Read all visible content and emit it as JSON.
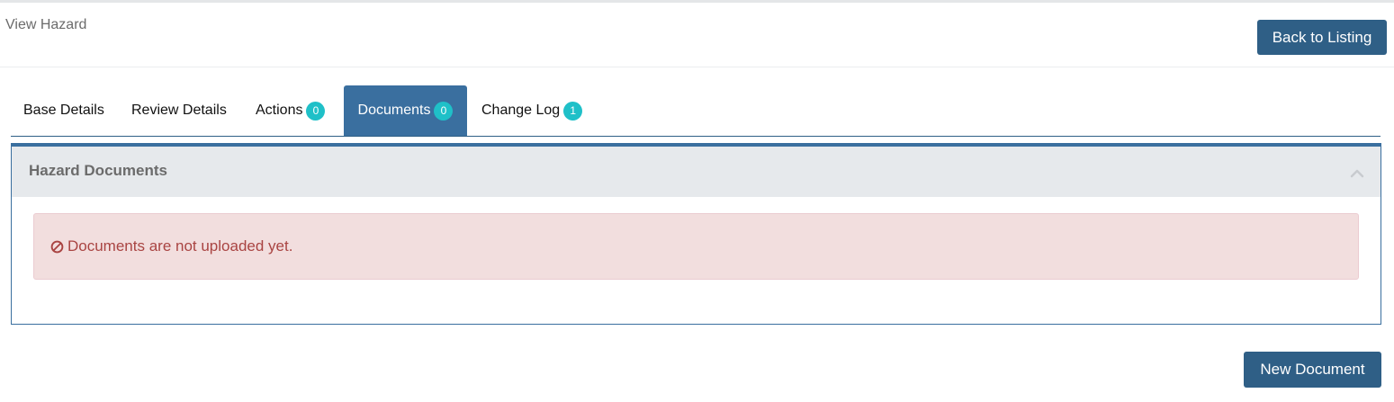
{
  "header": {
    "title": "View Hazard",
    "back_label": "Back to Listing"
  },
  "tabs": [
    {
      "label": "Base Details",
      "badge": null,
      "active": false
    },
    {
      "label": "Review Details",
      "badge": null,
      "active": false
    },
    {
      "label": "Actions",
      "badge": "0",
      "active": false
    },
    {
      "label": "Documents",
      "badge": "0",
      "active": true
    },
    {
      "label": "Change Log",
      "badge": "1",
      "active": false
    }
  ],
  "panel": {
    "title": "Hazard Documents",
    "collapse_icon": "chevron-up-icon",
    "alert": {
      "icon": "ban-icon",
      "message": "Documents are not uploaded yet."
    }
  },
  "footer": {
    "new_document_label": "New Document"
  },
  "colors": {
    "primary": "#2f5f86",
    "tab_active": "#3a6f9f",
    "badge": "#1fc0c8",
    "alert_bg": "#f2dede",
    "alert_text": "#a94442"
  }
}
